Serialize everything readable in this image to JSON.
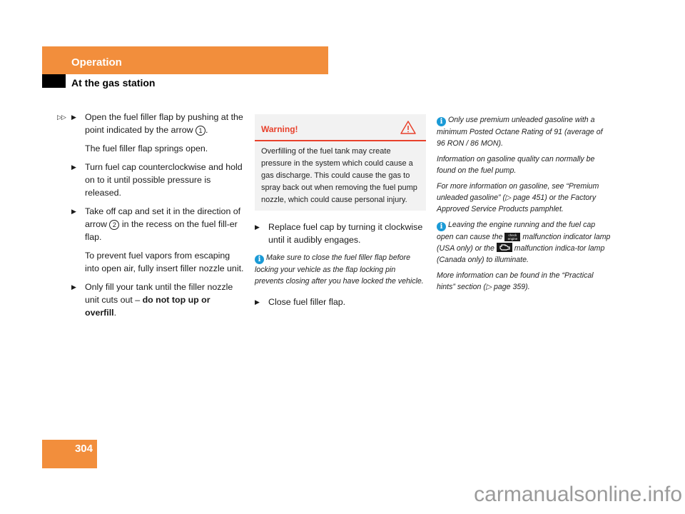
{
  "header": {
    "section": "Operation",
    "subsection": "At the gas station"
  },
  "column1": {
    "continuation_marker": "▷▷",
    "step1": {
      "before": "Open the fuel filler flap by pushing at the point indicated by the arrow ",
      "callout": "1",
      "after": "."
    },
    "step1_result": "The fuel filler flap springs open.",
    "step2": "Turn fuel cap counterclockwise and hold on to it until possible pressure is released.",
    "step3": {
      "before": "Take off cap and set it in the direction of arrow ",
      "callout": "2",
      "after": " in the recess on the fuel fill-er flap."
    },
    "step3_note": "To prevent fuel vapors from escaping into open air, fully insert filler nozzle unit.",
    "step4": {
      "before": "Only fill your tank until the filler nozzle unit cuts out – ",
      "bold": "do not top up or overfill",
      "after": "."
    }
  },
  "column2": {
    "warning": {
      "title": "Warning!",
      "icon": "warning-triangle-icon",
      "body": "Overfilling of the fuel tank may create pressure in the system which could cause a gas discharge. This could cause the gas to spray back out when removing the fuel pump nozzle, which could cause personal injury."
    },
    "step5": "Replace fuel cap by turning it clockwise until it audibly engages.",
    "note": "Make sure to close the fuel filler flap before locking your vehicle as the flap locking pin prevents closing after you have locked the vehicle.",
    "step6": "Close fuel filler flap."
  },
  "column3": {
    "note1": "Only use premium unleaded gasoline with a minimum Posted Octane Rating of 91  (average of 96 RON / 86 MON).",
    "note1_p2": "Information on gasoline quality can normally be found on the fuel pump.",
    "note1_p3_before": "For more information on gasoline, see “Premium unleaded gasoline” (",
    "note1_p3_ref": "▷ page 451",
    "note1_p3_after": ") or the Factory Approved Service Products pamphlet.",
    "note2_a": "Leaving the engine running and the fuel cap open can cause the ",
    "lamp_check_engine": "check engine",
    "note2_b": " malfunction indicator lamp (USA only) or the ",
    "note2_c": " malfunction indica-tor lamp (Canada only) to illuminate.",
    "note2_p2_before": "More information can be found in the “Practical hints” section (",
    "note2_p2_ref": "▷ page 359",
    "note2_p2_after": ")."
  },
  "footer": {
    "page_number": "304",
    "watermark": "carmanualsonline.info"
  },
  "colors": {
    "accent_orange": "#f28e3c",
    "warning_red": "#e8412c",
    "info_blue": "#1a9ad6"
  },
  "icons": {
    "bullet": "▶",
    "info": "i"
  }
}
